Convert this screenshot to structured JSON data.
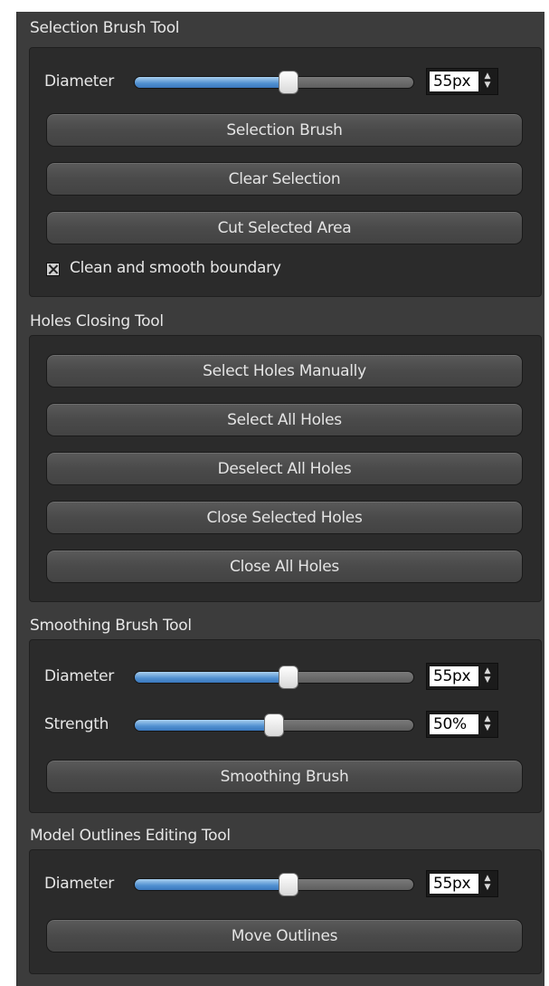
{
  "sections": {
    "selection": {
      "title": "Selection Brush Tool",
      "diameter": {
        "label": "Diameter",
        "value": "55px",
        "level": 0.55
      },
      "buttons": [
        "Selection Brush",
        "Clear Selection",
        "Cut Selected Area"
      ],
      "checkbox": {
        "label": "Clean and smooth boundary",
        "checked": true
      }
    },
    "holes": {
      "title": "Holes Closing Tool",
      "buttons": [
        "Select Holes Manually",
        "Select All Holes",
        "Deselect All Holes",
        "Close Selected Holes",
        "Close All Holes"
      ]
    },
    "smoothing": {
      "title": "Smoothing Brush Tool",
      "diameter": {
        "label": "Diameter",
        "value": "55px",
        "level": 0.55
      },
      "strength": {
        "label": "Strength",
        "value": "50%",
        "level": 0.5
      },
      "buttons": [
        "Smoothing Brush"
      ]
    },
    "outlines": {
      "title": "Model Outlines Editing Tool",
      "diameter": {
        "label": "Diameter",
        "value": "55px",
        "level": 0.55
      },
      "buttons": [
        "Move Outlines"
      ]
    }
  },
  "icons": {
    "spin_arrows": "up-down-arrows-icon",
    "checkbox": "checked-box-icon"
  },
  "colors": {
    "panel": "#3c3c3c",
    "group": "#2b2b2b",
    "accent": "#4f8fd0"
  }
}
